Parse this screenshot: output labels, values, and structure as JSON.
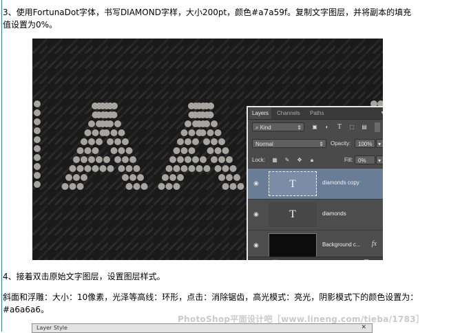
{
  "steps": {
    "step3": "3、使用FortunaDot字体，书写DIAMOND字样，大小200pt，颜色#a7a59f。复制文字图层，并将副本的填充值设置为0%。",
    "step4": "4、接着双击原始文字图层，设置图层样式。",
    "step4b": "斜面和浮雕：大小：10像素，光泽等高线：环形，点击：消除锯齿，高光模式：亮光，阴影模式下的颜色设置为：#a6a6a6。"
  },
  "colors": {
    "text_fill": "#a7a59f",
    "selected_layer": "#6a7d96",
    "panel_bg": "#4a4a4a"
  },
  "panel": {
    "tabs": [
      "Layers",
      "Channels",
      "Paths"
    ],
    "menu_icon": "panel-menu-icon",
    "filter_label": "Kind",
    "blend_mode": "Normal",
    "opacity_label": "Opacity:",
    "opacity_value": "100%",
    "lock_label": "Lock:",
    "fill_label": "Fill:",
    "fill_value": "0%",
    "layers": [
      {
        "name": "diamonds copy",
        "thumb": "T",
        "selected": true
      },
      {
        "name": "diamonds",
        "thumb": "T",
        "selected": false
      },
      {
        "name": "Background c...",
        "thumb": "",
        "selected": false,
        "fx": "fx"
      }
    ],
    "bottom_icons": [
      "link-icon",
      "fx-icon",
      "mask-icon",
      "adjustment-icon",
      "folder-icon",
      "new-layer-icon",
      "trash-icon"
    ],
    "fx_glyph": "fx"
  },
  "watermark": "PhotoShop平面设计吧［www.lineng.com/tieba/1783］",
  "dialog": {
    "title": "Layer Style",
    "close": "✕"
  }
}
